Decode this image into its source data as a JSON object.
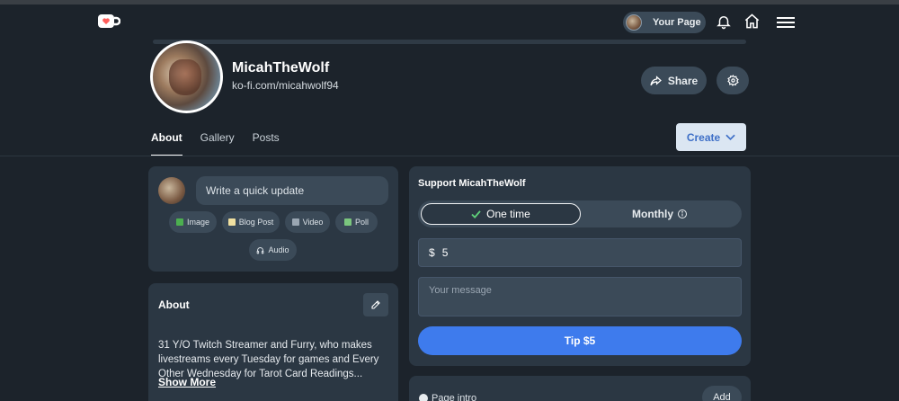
{
  "header": {
    "your_page_label": "Your Page"
  },
  "profile": {
    "name": "MicahTheWolf",
    "url": "ko-fi.com/micahwolf94",
    "share_label": "Share"
  },
  "tabs": [
    {
      "label": "About",
      "active": true
    },
    {
      "label": "Gallery",
      "active": false
    },
    {
      "label": "Posts",
      "active": false
    }
  ],
  "create_label": "Create",
  "quick_update": {
    "placeholder": "Write a quick update",
    "chips": [
      {
        "label": "Image",
        "icon": "image-icon"
      },
      {
        "label": "Blog Post",
        "icon": "blog-post-icon"
      },
      {
        "label": "Video",
        "icon": "video-icon"
      },
      {
        "label": "Poll",
        "icon": "poll-icon"
      },
      {
        "label": "Audio",
        "icon": "headphones-icon"
      }
    ]
  },
  "about": {
    "title": "About",
    "text": "31 Y/O Twitch Streamer and Furry, who makes livestreams every Tuesday for games and Every Other Wednesday for Tarot Card Readings...",
    "show_more": "Show More"
  },
  "support": {
    "title": "Support MicahTheWolf",
    "one_time": "One time",
    "monthly": "Monthly",
    "currency": "$",
    "amount": "5",
    "message_placeholder": "Your message",
    "tip_label": "Tip $5"
  },
  "page_card": {
    "label": "Page intro",
    "add_label": "Add"
  },
  "colors": {
    "background": "#1c232b",
    "card": "#2b3743",
    "chip": "#3b4a58",
    "accent": "#3e7bed"
  }
}
